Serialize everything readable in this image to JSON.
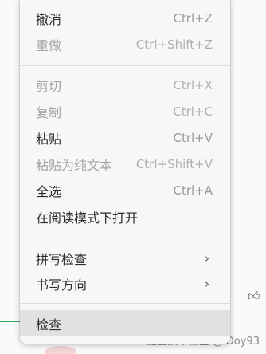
{
  "menu": {
    "groups": [
      {
        "items": [
          {
            "label": "撤消",
            "shortcut": "Ctrl+Z",
            "disabled": false
          },
          {
            "label": "重做",
            "shortcut": "Ctrl+Shift+Z",
            "disabled": true
          }
        ]
      },
      {
        "items": [
          {
            "label": "剪切",
            "shortcut": "Ctrl+X",
            "disabled": true
          },
          {
            "label": "复制",
            "shortcut": "Ctrl+C",
            "disabled": true
          },
          {
            "label": "粘贴",
            "shortcut": "Ctrl+V",
            "disabled": false
          },
          {
            "label": "粘贴为纯文本",
            "shortcut": "Ctrl+Shift+V",
            "disabled": true
          },
          {
            "label": "全选",
            "shortcut": "Ctrl+A",
            "disabled": false
          },
          {
            "label": "在阅读模式下打开",
            "shortcut": "",
            "disabled": false
          }
        ]
      },
      {
        "items": [
          {
            "label": "拼写检查",
            "submenu_icon": "chevron-right-icon",
            "disabled": false
          },
          {
            "label": "书写方向",
            "submenu_icon": "chevron-right-icon",
            "disabled": false
          }
        ]
      },
      {
        "items": [
          {
            "label": "检查",
            "shortcut": "",
            "disabled": false,
            "hovered": true
          }
        ]
      }
    ]
  },
  "background": {
    "watermark": "掘金技术社区 @ Doy93",
    "icons": [
      "speaker-icon",
      "thumbs-up-icon"
    ],
    "accent_line_color": "#35a66a"
  },
  "colors": {
    "menu_bg": "#f7f7f7",
    "hover_bg": "#e1e1e1",
    "text": "#2b2b2b",
    "disabled_text": "#a3a3a3",
    "shortcut_text": "#9a9a9a"
  }
}
